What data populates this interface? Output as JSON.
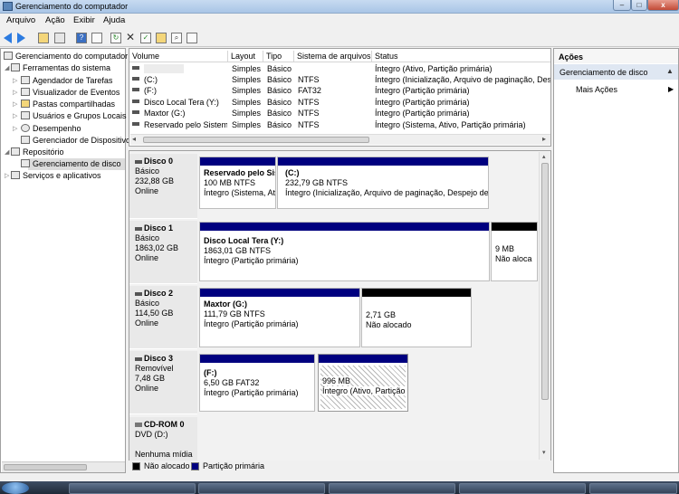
{
  "window": {
    "title": "Gerenciamento do computador"
  },
  "titlebar_buttons": {
    "minimize": "–",
    "maximize": "□",
    "close": "x"
  },
  "menubar": [
    "Arquivo",
    "Ação",
    "Exibir",
    "Ajuda"
  ],
  "toolbar": [
    "back-icon",
    "forward-icon",
    "up-folder-icon",
    "show-hide-tree-icon",
    "help-icon",
    "properties-icon",
    "refresh-icon",
    "delete-icon",
    "check-icon",
    "open-icon",
    "search-icon",
    "export-icon"
  ],
  "tree": {
    "root": "Gerenciamento do computador (l",
    "items": [
      {
        "label": "Ferramentas do sistema",
        "level": 1
      },
      {
        "label": "Agendador de Tarefas",
        "level": 2
      },
      {
        "label": "Visualizador de Eventos",
        "level": 2
      },
      {
        "label": "Pastas compartilhadas",
        "level": 2
      },
      {
        "label": "Usuários e Grupos Locais",
        "level": 2
      },
      {
        "label": "Desempenho",
        "level": 2
      },
      {
        "label": "Gerenciador de Dispositivo",
        "level": 2
      },
      {
        "label": "Repositório",
        "level": 1
      },
      {
        "label": "Gerenciamento de disco",
        "level": 2,
        "selected": true
      },
      {
        "label": "Serviços e aplicativos",
        "level": 1
      }
    ]
  },
  "volume_list": {
    "columns": [
      "Volume",
      "Layout",
      "Tipo",
      "Sistema de arquivos",
      "Status"
    ],
    "rows": [
      [
        "",
        "Simples",
        "Básico",
        "",
        "Íntegro (Ativo, Partição primária)"
      ],
      [
        "(C:)",
        "Simples",
        "Básico",
        "NTFS",
        "Íntegro (Inicialização, Arquivo de paginação, Desp"
      ],
      [
        "(F:)",
        "Simples",
        "Básico",
        "FAT32",
        "Íntegro (Partição primária)"
      ],
      [
        "Disco Local  Tera (Y:)",
        "Simples",
        "Básico",
        "NTFS",
        "Íntegro (Partição primária)"
      ],
      [
        "Maxtor (G:)",
        "Simples",
        "Básico",
        "NTFS",
        "Íntegro (Partição primária)"
      ],
      [
        "Reservado pelo Sistema",
        "Simples",
        "Básico",
        "NTFS",
        "Íntegro (Sistema, Ativo, Partição primária)"
      ]
    ]
  },
  "disks": [
    {
      "name": "Disco 0",
      "type": "Básico",
      "size": "232,88 GB",
      "state": "Online",
      "partitions": [
        {
          "name": "Reservado pelo Sis",
          "size": "100 MB NTFS",
          "status": "Íntegro (Sistema, At",
          "kind": "primary"
        },
        {
          "name": "(C:)",
          "size": "232,79 GB NTFS",
          "status": "Íntegro (Inicialização, Arquivo de paginação, Despejo de m",
          "kind": "primary"
        }
      ]
    },
    {
      "name": "Disco 1",
      "type": "Básico",
      "size": "1863,02 GB",
      "state": "Online",
      "partitions": [
        {
          "name": "Disco Local  Tera  (Y:)",
          "size": "1863,01 GB NTFS",
          "status": "Íntegro (Partição primária)",
          "kind": "primary"
        },
        {
          "name": "",
          "size": "9 MB",
          "status": "Não aloca",
          "kind": "unallocated"
        }
      ]
    },
    {
      "name": "Disco 2",
      "type": "Básico",
      "size": "114,50 GB",
      "state": "Online",
      "partitions": [
        {
          "name": "Maxtor  (G:)",
          "size": "111,79 GB NTFS",
          "status": "Íntegro (Partição primária)",
          "kind": "primary"
        },
        {
          "name": "",
          "size": "2,71 GB",
          "status": "Não alocado",
          "kind": "unallocated"
        }
      ]
    },
    {
      "name": "Disco 3",
      "type": "Removível",
      "size": "7,48 GB",
      "state": "Online",
      "partitions": [
        {
          "name": "(F:)",
          "size": "6,50 GB FAT32",
          "status": "Íntegro (Partição primária)",
          "kind": "primary"
        },
        {
          "name": "",
          "size": "996 MB",
          "status": "Íntegro (Ativo, Partição",
          "kind": "primary-selected"
        }
      ]
    },
    {
      "name": "CD-ROM 0",
      "type": "DVD (D:)",
      "size": "",
      "state": "Nenhuma mídia",
      "partitions": []
    }
  ],
  "legend": [
    {
      "label": "Não alocado",
      "color": "#000000"
    },
    {
      "label": "Partição primária",
      "color": "#00007f"
    }
  ],
  "actions": {
    "header": "Ações",
    "section": "Gerenciamento de disco",
    "items": [
      "Mais Ações"
    ]
  }
}
